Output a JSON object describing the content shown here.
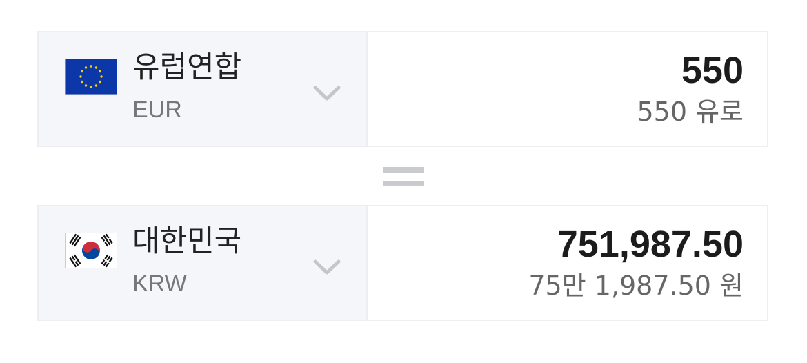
{
  "converter": {
    "from": {
      "country": "유럽연합",
      "code": "EUR",
      "amount": "550",
      "amount_words": "550 유로",
      "flag_icon": "eu-flag-icon"
    },
    "to": {
      "country": "대한민국",
      "code": "KRW",
      "amount": "751,987.50",
      "amount_words": "75만 1,987.50 원",
      "flag_icon": "korea-flag-icon"
    }
  },
  "colors": {
    "panel_bg": "#f4f6f9",
    "border": "#eceef1",
    "eu_blue": "#0c37a8",
    "eu_star": "#f5d20a",
    "kr_red": "#cd2e3a",
    "kr_blue": "#0047a0",
    "equals_gray": "#c9cbce"
  }
}
